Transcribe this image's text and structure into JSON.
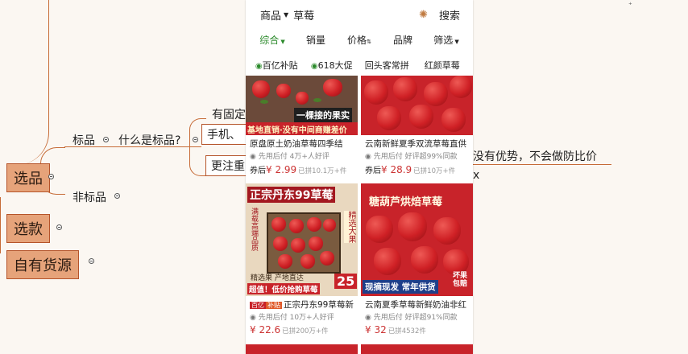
{
  "mindmap": {
    "main_nodes": [
      "选品",
      "选款",
      "自有货源"
    ],
    "branch_labels": [
      "标品",
      "非标品"
    ],
    "question": "什么是标品?",
    "partial_texts": {
      "fixed": "有固定",
      "phone": "手机、",
      "more": "更注重",
      "right_text": "没有优势，不会做防比价",
      "right_tail": "x"
    }
  },
  "phone": {
    "topbar": {
      "category": "商品",
      "keyword": "草莓",
      "search": "搜索"
    },
    "sort_options": [
      "综合",
      "销量",
      "价格",
      "品牌",
      "筛选"
    ],
    "tags": [
      "百亿补贴",
      "618大促",
      "回头客常拼",
      "红颜草莓"
    ],
    "products": [
      {
        "title": "原盘原土奶油草莓四季结",
        "meta": "先用后付 4万+人好评",
        "price_prefix": "券后",
        "price": "¥ 2.99",
        "sold": "已拼10.1万+件",
        "banner_top": "一棵接的果实",
        "banner_bottom": "基地直销·没有中间商赚差价"
      },
      {
        "title": "云南新鲜夏季双流草莓直供",
        "meta": "先用后付 好评超99%同款",
        "price_prefix": "券后",
        "price": "¥ 28.9",
        "sold": "已拼10万+件"
      },
      {
        "title": "正宗丹东99草莓新",
        "badges": [
          "百亿",
          "补贴"
        ],
        "meta": "先用后付 10万+人好评",
        "price": "¥ 22.6",
        "sold": "已拼200万+件",
        "banner_top": "正宗丹东99草莓",
        "banner_side": "精选大果",
        "banner_small": "精选果 产地直达",
        "banner_bottom": "超值！低价抢购草莓",
        "banner_num": "25",
        "side_label": "满载高端品质"
      },
      {
        "title": "云南夏季草莓新鲜奶油非红",
        "meta": "先用后付 好评超91%同款",
        "price": "¥ 32",
        "sold": "已拼4532件",
        "banner_top": "糖葫芦烘焙草莓",
        "banner_bottom": "现摘现发 常年供货",
        "banner_corner": "坏果包赔"
      }
    ]
  },
  "colors": {
    "mindmap_node": "#e6a37a",
    "mindmap_line": "#c66b37",
    "accent_green": "#2b8a2b",
    "price_red": "#c33"
  }
}
